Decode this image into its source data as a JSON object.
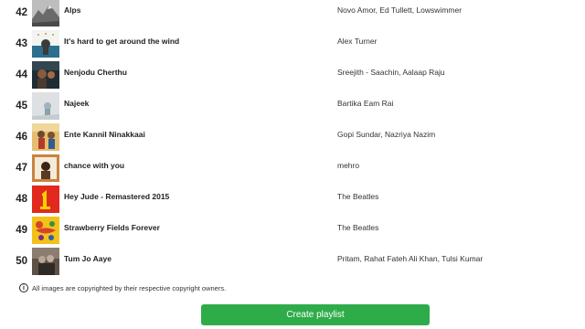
{
  "tracks": [
    {
      "rank": "42",
      "title": "Alps",
      "artist": "Novo Amor, Ed Tullett, Lowswimmer",
      "art_icon": "album-art-alps",
      "art_colors": [
        "#b9b9b9",
        "#6f6f6f"
      ]
    },
    {
      "rank": "43",
      "title": "It's hard to get around the wind",
      "artist": "Alex Turner",
      "art_icon": "album-art-hard-to-get-around-the-wind",
      "art_colors": [
        "#eef2ef",
        "#2a6f8f"
      ]
    },
    {
      "rank": "44",
      "title": "Nenjodu Cherthu",
      "artist": "Sreejith - Saachin, Aalaap Raju",
      "art_icon": "album-art-nenjodu-cherthu",
      "art_colors": [
        "#1d2b33",
        "#8a5a3c"
      ]
    },
    {
      "rank": "45",
      "title": "Najeek",
      "artist": "Bartika Eam Rai",
      "art_icon": "album-art-najeek",
      "art_colors": [
        "#d9dde0",
        "#9fb3bd"
      ]
    },
    {
      "rank": "46",
      "title": "Ente Kannil Ninakkaai",
      "artist": "Gopi Sundar, Nazriya Nazim",
      "art_icon": "album-art-ente-kannil-ninakkaai",
      "art_colors": [
        "#e2b86a",
        "#6d4a2b"
      ]
    },
    {
      "rank": "47",
      "title": "chance with you",
      "artist": "mehro",
      "art_icon": "album-art-chance-with-you",
      "art_colors": [
        "#c8833f",
        "#3a2616"
      ]
    },
    {
      "rank": "48",
      "title": "Hey Jude - Remastered 2015",
      "artist": "The Beatles",
      "art_icon": "album-art-beatles-1",
      "art_colors": [
        "#e12a1d",
        "#f6d000"
      ]
    },
    {
      "rank": "49",
      "title": "Strawberry Fields Forever",
      "artist": "The Beatles",
      "art_icon": "album-art-strawberry-fields-forever",
      "art_colors": [
        "#f2c21b",
        "#d8432d"
      ]
    },
    {
      "rank": "50",
      "title": "Tum Jo Aaye",
      "artist": "Pritam, Rahat Fateh Ali Khan, Tulsi Kumar",
      "art_icon": "album-art-tum-jo-aaye",
      "art_colors": [
        "#5e5248",
        "#b7a596"
      ]
    }
  ],
  "copyright_note": "All images are copyrighted by their respective copyright owners.",
  "info_icon": "info-icon",
  "create_playlist_label": "Create playlist",
  "accent_color": "#2eac4a"
}
